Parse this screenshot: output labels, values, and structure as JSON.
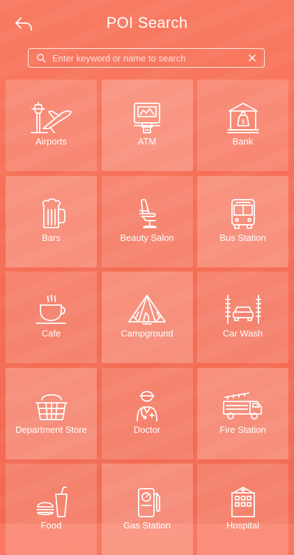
{
  "header": {
    "title": "POI Search",
    "back_icon": "back-arrow-icon"
  },
  "search": {
    "placeholder": "Enter keyword or name to search",
    "value": "",
    "icon": "search-icon",
    "clear_icon": "close-icon"
  },
  "categories": [
    {
      "label": "Airports",
      "icon": "airport-icon"
    },
    {
      "label": "ATM",
      "icon": "atm-icon"
    },
    {
      "label": "Bank",
      "icon": "bank-icon"
    },
    {
      "label": "Bars",
      "icon": "beer-mug-icon"
    },
    {
      "label": "Beauty Salon",
      "icon": "salon-chair-icon"
    },
    {
      "label": "Bus Station",
      "icon": "bus-icon"
    },
    {
      "label": "Cafe",
      "icon": "coffee-cup-icon"
    },
    {
      "label": "Campground",
      "icon": "tent-icon"
    },
    {
      "label": "Car Wash",
      "icon": "car-wash-icon"
    },
    {
      "label": "Department Store",
      "icon": "shopping-basket-icon"
    },
    {
      "label": "Doctor",
      "icon": "doctor-icon"
    },
    {
      "label": "Fire Station",
      "icon": "fire-truck-icon"
    },
    {
      "label": "Food",
      "icon": "fast-food-icon"
    },
    {
      "label": "Gas Station",
      "icon": "gas-pump-icon"
    },
    {
      "label": "Hospital",
      "icon": "hospital-building-icon"
    }
  ],
  "colors": {
    "background": "#f56e55",
    "tile": "#ffffff29",
    "text": "#ffffff"
  }
}
